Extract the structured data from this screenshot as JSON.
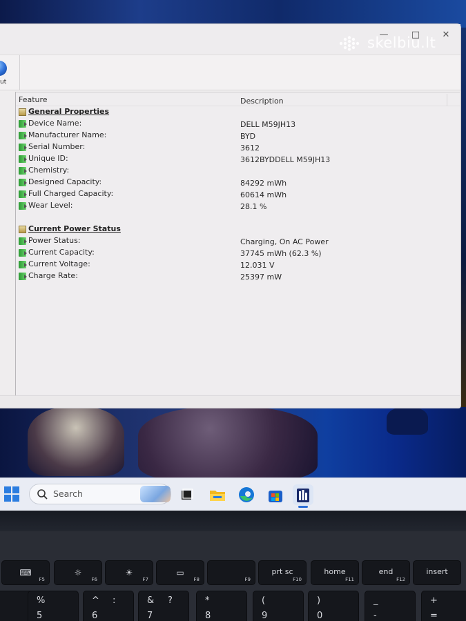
{
  "watermark": {
    "text": "skelbiu.lt"
  },
  "window": {
    "controls": {
      "minimize": "—",
      "maximize": "□",
      "close": "✕"
    },
    "toolbar": {
      "partial_label": "ut"
    }
  },
  "table": {
    "headers": {
      "feature": "Feature",
      "description": "Description"
    },
    "groups": [
      {
        "title": "General Properties",
        "rows": [
          {
            "label": "Device Name:",
            "value": "DELL M59JH13"
          },
          {
            "label": "Manufacturer Name:",
            "value": "BYD"
          },
          {
            "label": "Serial Number:",
            "value": "3612"
          },
          {
            "label": "Unique ID:",
            "value": "3612BYDDELL M59JH13"
          },
          {
            "label": "Chemistry:",
            "value": ""
          },
          {
            "label": "Designed Capacity:",
            "value": "84292 mWh"
          },
          {
            "label": "Full Charged Capacity:",
            "value": "60614 mWh"
          },
          {
            "label": "Wear Level:",
            "value": "28.1 %"
          }
        ]
      },
      {
        "title": "Current Power Status",
        "rows": [
          {
            "label": "Power Status:",
            "value": "Charging, On AC Power"
          },
          {
            "label": "Current Capacity:",
            "value": "37745 mWh (62.3 %)"
          },
          {
            "label": "Current Voltage:",
            "value": "12.031 V"
          },
          {
            "label": "Charge Rate:",
            "value": "25397 mW"
          }
        ]
      }
    ]
  },
  "taskbar": {
    "search_label": "Search",
    "apps": [
      "task-view",
      "file-explorer",
      "edge",
      "microsoft-store",
      "batteryinfoview"
    ],
    "accent": "#2b7de0"
  },
  "keyboard": {
    "fn_row": [
      {
        "icon": "keyboard-backlight",
        "sub": "F5"
      },
      {
        "icon": "brightness-down",
        "sub": "F6"
      },
      {
        "icon": "brightness-up",
        "sub": "F7"
      },
      {
        "icon": "display-switch",
        "sub": "F8"
      },
      {
        "icon": "",
        "sub": "F9"
      },
      {
        "main": "prt sc",
        "sub": "F10"
      },
      {
        "main": "home",
        "sub": "F11"
      },
      {
        "main": "end",
        "sub": "F12"
      },
      {
        "main": "insert",
        "sub": ""
      }
    ],
    "number_row": [
      {
        "top": ";",
        "bottom": ""
      },
      {
        "top": "%",
        "bottom": "5"
      },
      {
        "top": "^",
        "mid": ":",
        "bottom": "6"
      },
      {
        "top": "&",
        "mid": "?",
        "bottom": "7"
      },
      {
        "top": "*",
        "bottom": "8"
      },
      {
        "top": "(",
        "bottom": "9"
      },
      {
        "top": ")",
        "bottom": "0"
      },
      {
        "top": "_",
        "bottom": "-"
      },
      {
        "top": "+",
        "bottom": "="
      }
    ]
  }
}
